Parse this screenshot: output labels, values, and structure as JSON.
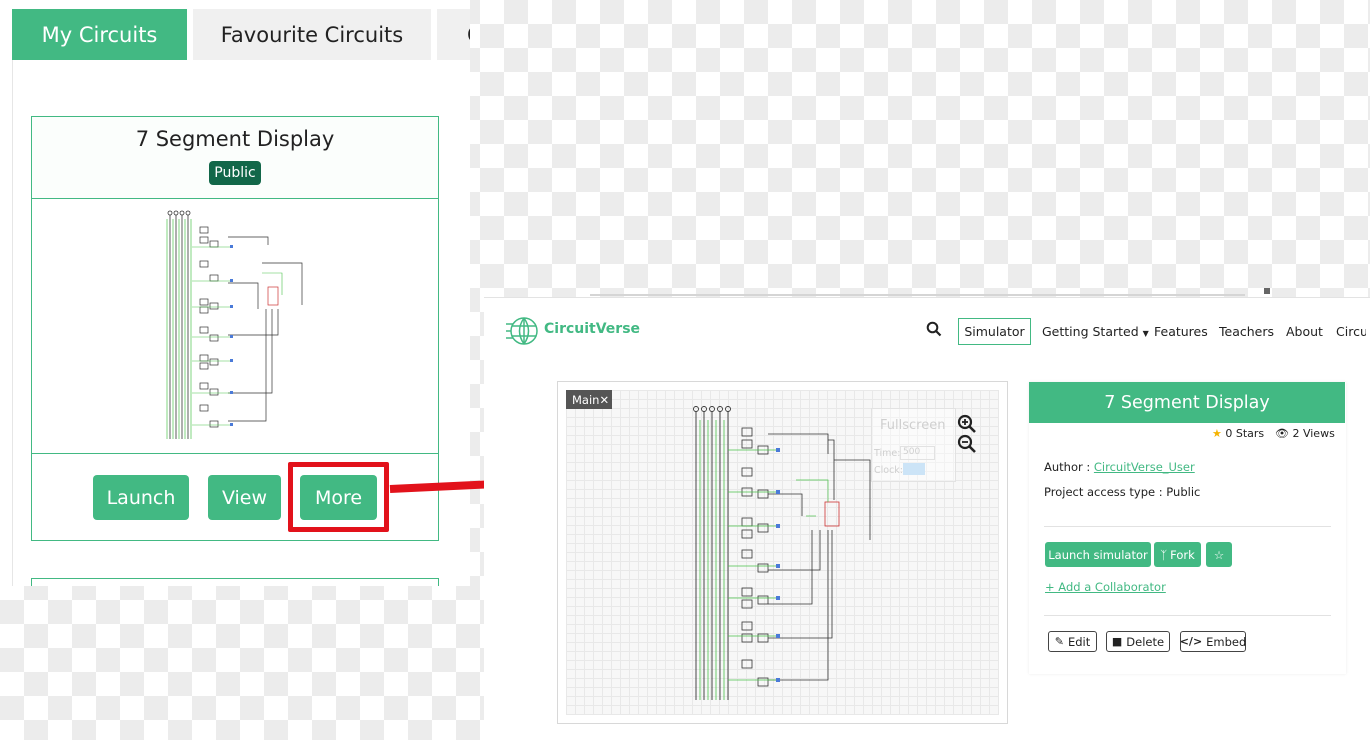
{
  "left": {
    "tabs": [
      {
        "label": "My Circuits",
        "active": true
      },
      {
        "label": "Favourite Circuits",
        "active": false
      },
      {
        "label": "C",
        "active": false
      }
    ],
    "card": {
      "title": "7 Segment Display",
      "badge": "Public",
      "buttons": {
        "launch": "Launch",
        "view": "View",
        "more": "More"
      }
    },
    "highlight_color": "#e2121b"
  },
  "right": {
    "brand": "CircuitVerse",
    "nav": {
      "simulator": "Simulator",
      "getting_started": "Getting Started",
      "features": "Features",
      "teachers": "Teachers",
      "about": "About",
      "truncated": "Circu"
    },
    "canvas": {
      "main_tab": "Main",
      "fullscreen": "Fullscreen",
      "time_label": "Time:",
      "time_value": "500",
      "clock_label": "Clock:"
    },
    "project": {
      "title": "7 Segment Display",
      "stars": "0 Stars",
      "views": "2 Views",
      "author_label": "Author :",
      "author": "CircuitVerse_User",
      "access_label": "Project access type :",
      "access": "Public",
      "launch_simulator": "Launch simulator",
      "fork": "Fork",
      "add_collaborator": "+ Add a Collaborator",
      "edit": "Edit",
      "delete": "Delete",
      "embed": "Embed"
    }
  },
  "colors": {
    "brand_green": "#42b983",
    "badge_green": "#126749",
    "arrow_red": "#e2121b"
  }
}
